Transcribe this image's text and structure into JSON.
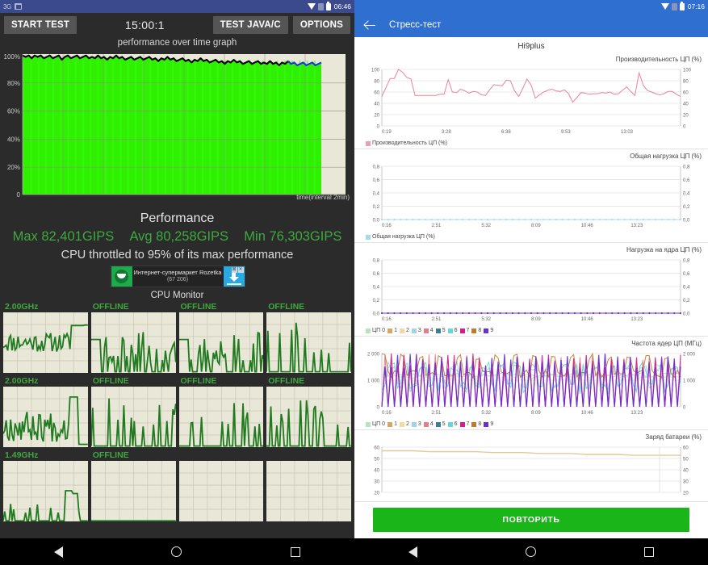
{
  "left": {
    "statusbar": {
      "network": "3G",
      "clock": "06:46",
      "icons": [
        "screenshot-icon",
        "wifi-icon",
        "sim-icon",
        "battery-icon"
      ]
    },
    "toolbar": {
      "start_test": "START TEST",
      "timer": "15:00:1",
      "test_java_c": "TEST JAVA/C",
      "options": "OPTIONS"
    },
    "graph": {
      "title": "performance over time graph",
      "x_axis_label": "time(interval 2min)",
      "y_ticks": [
        "100%",
        "80%",
        "60%",
        "40%",
        "20%",
        "0"
      ]
    },
    "performance": {
      "heading": "Performance",
      "max": "Max 82,401GIPS",
      "avg": "Avg 80,258GIPS",
      "min": "Min 76,303GIPS",
      "throttle_note": "CPU throttled to 95% of its max performance",
      "accent_color": "#3ea93e"
    },
    "ad": {
      "title": "Интернет-супермаркет Rozetka",
      "subtitle": "(67 206)",
      "close_labels": [
        "⊠",
        "✕"
      ]
    },
    "cpu_monitor": {
      "title": "CPU Monitor",
      "cores": [
        {
          "label": "2.00GHz"
        },
        {
          "label": "OFFLINE"
        },
        {
          "label": "OFFLINE"
        },
        {
          "label": "OFFLINE"
        },
        {
          "label": "2.00GHz"
        },
        {
          "label": "OFFLINE"
        },
        {
          "label": "OFFLINE"
        },
        {
          "label": "OFFLINE"
        },
        {
          "label": "1.49GHz"
        },
        {
          "label": "OFFLINE"
        },
        {
          "label": ""
        },
        {
          "label": ""
        }
      ]
    }
  },
  "right": {
    "statusbar": {
      "clock": "07:16",
      "icons": [
        "wifi-icon",
        "sim-icon",
        "battery-icon"
      ]
    },
    "appbar": {
      "title": "Стресс-тест",
      "back": "back-arrow"
    },
    "device_name": "Hi9plus",
    "repeat_button": "ПОВТОРИТЬ",
    "charts": [
      {
        "title": "Производительность ЦП (%)",
        "legend": [
          {
            "label": "Производительность ЦП (%)",
            "color": "#e8a0b4"
          }
        ],
        "y_ticks": [
          "100",
          "80",
          "60",
          "40",
          "20",
          "0"
        ],
        "x_ticks": [
          "0:19",
          "3:28",
          "6:38",
          "9:53",
          "13:03"
        ]
      },
      {
        "title": "Общая нагрузка ЦП (%)",
        "legend": [
          {
            "label": "Общая нагрузка ЦП (%)",
            "color": "#a5dced"
          }
        ],
        "y_ticks": [
          "0,8",
          "0,6",
          "0,4",
          "0,2",
          "0,0"
        ],
        "x_ticks": [
          "0:16",
          "2:51",
          "5:32",
          "8:09",
          "10:46",
          "13:23"
        ]
      },
      {
        "title": "Нагрузка на ядра ЦП (%)",
        "legend": [
          {
            "label": "ЦП 0",
            "color": "#b9e3bd"
          },
          {
            "label": "1",
            "color": "#d6a866"
          },
          {
            "label": "2",
            "color": "#f2d9a0"
          },
          {
            "label": "3",
            "color": "#9fd4e8"
          },
          {
            "label": "4",
            "color": "#e8798f"
          },
          {
            "label": "5",
            "color": "#3a7f96"
          },
          {
            "label": "6",
            "color": "#5fd9de"
          },
          {
            "label": "7",
            "color": "#d81b8c"
          },
          {
            "label": "8",
            "color": "#c07a28"
          },
          {
            "label": "9",
            "color": "#6a2fd0"
          }
        ],
        "y_ticks": [
          "0,8",
          "0,6",
          "0,4",
          "0,2",
          "0,0"
        ],
        "x_ticks": [
          "0:16",
          "2:51",
          "5:32",
          "8:09",
          "10:46",
          "13:23"
        ]
      },
      {
        "title": "Частота ядер ЦП (МГц)",
        "legend": [
          {
            "label": "ЦП 0",
            "color": "#b9e3bd"
          },
          {
            "label": "1",
            "color": "#d6a866"
          },
          {
            "label": "2",
            "color": "#f2d9a0"
          },
          {
            "label": "3",
            "color": "#9fd4e8"
          },
          {
            "label": "4",
            "color": "#e8798f"
          },
          {
            "label": "5",
            "color": "#3a7f96"
          },
          {
            "label": "6",
            "color": "#5fd9de"
          },
          {
            "label": "7",
            "color": "#d81b8c"
          },
          {
            "label": "8",
            "color": "#c07a28"
          },
          {
            "label": "9",
            "color": "#6a2fd0"
          }
        ],
        "y_ticks": [
          "2 000",
          "1 000",
          "0"
        ],
        "x_ticks": [
          "0:16",
          "2:51",
          "5:32",
          "8:09",
          "10:46",
          "13:23"
        ]
      },
      {
        "title": "Заряд батареи (%)",
        "legend": [],
        "y_ticks": [
          "60",
          "50",
          "40",
          "30",
          "20"
        ],
        "x_ticks": []
      }
    ]
  },
  "navbar": {
    "back": "back-triangle-icon",
    "home": "home-circle-icon",
    "recent": "recent-square-icon"
  },
  "chart_data": [
    {
      "type": "area",
      "title": "performance over time graph",
      "xlabel": "time(interval 2min)",
      "ylabel": "%",
      "ylim": [
        0,
        100
      ],
      "series": [
        {
          "name": "performance",
          "color": "#000000",
          "values": [
            99,
            98,
            99,
            97,
            99,
            98,
            99,
            97,
            98,
            99,
            97,
            98,
            99,
            96,
            98,
            99,
            97,
            98,
            99,
            97,
            98,
            99,
            97,
            98,
            97,
            99,
            97,
            98,
            96,
            98,
            97,
            99,
            97,
            98,
            96,
            97,
            98,
            96,
            97,
            98,
            96,
            97,
            98,
            96,
            97,
            95,
            97,
            96,
            98,
            96,
            97,
            95,
            96,
            97,
            95,
            96,
            94,
            96,
            95,
            97,
            95,
            96,
            94,
            95,
            96,
            94,
            95,
            93,
            95,
            94,
            96,
            94,
            95,
            93,
            94,
            95,
            93,
            94,
            95,
            93,
            94,
            93,
            95,
            93,
            94,
            92,
            94,
            93,
            95,
            93,
            94,
            92,
            93,
            94,
            92,
            93,
            94,
            92,
            93,
            94
          ]
        }
      ]
    },
    {
      "type": "line",
      "title": "Производительность ЦП (%)",
      "ylim": [
        0,
        100
      ],
      "ylabel": "%",
      "x_ticks": [
        "0:19",
        "3:28",
        "6:38",
        "9:53",
        "13:03"
      ],
      "series": [
        {
          "name": "Производительность ЦП (%)",
          "color": "#e8849c",
          "values": [
            52,
            68,
            84,
            84,
            100,
            95,
            86,
            83,
            54,
            54,
            54,
            54,
            54,
            54,
            56,
            56,
            82,
            60,
            59,
            65,
            62,
            58,
            61,
            60,
            55,
            54,
            64,
            73,
            72,
            71,
            81,
            80,
            62,
            52,
            67,
            83,
            72,
            49,
            55,
            60,
            63,
            65,
            62,
            61,
            64,
            57,
            42,
            50,
            59,
            58,
            56,
            57,
            57,
            59,
            58,
            60,
            56,
            57,
            63,
            69,
            61,
            54,
            94,
            72,
            63,
            60,
            57,
            55,
            57,
            61,
            61,
            56,
            52
          ]
        }
      ]
    },
    {
      "type": "line",
      "title": "Общая нагрузка ЦП (%)",
      "ylim": [
        0,
        0.9
      ],
      "x_ticks": [
        "0:16",
        "2:51",
        "5:32",
        "8:09",
        "10:46",
        "13:23"
      ],
      "series": [
        {
          "name": "Общая нагрузка ЦП (%)",
          "color": "#a5dced",
          "values": [
            0
          ]
        }
      ]
    },
    {
      "type": "line",
      "title": "Нагрузка на ядра ЦП (%)",
      "ylim": [
        0,
        0.9
      ],
      "x_ticks": [
        "0:16",
        "2:51",
        "5:32",
        "8:09",
        "10:46",
        "13:23"
      ],
      "series": [
        {
          "name": "ЦП 0",
          "color": "#b9e3bd",
          "values": [
            0
          ]
        },
        {
          "name": "1",
          "color": "#d6a866",
          "values": [
            0
          ]
        },
        {
          "name": "2",
          "color": "#f2d9a0",
          "values": [
            0
          ]
        },
        {
          "name": "3",
          "color": "#9fd4e8",
          "values": [
            0
          ]
        },
        {
          "name": "4",
          "color": "#e8798f",
          "values": [
            0
          ]
        },
        {
          "name": "5",
          "color": "#3a7f96",
          "values": [
            0
          ]
        },
        {
          "name": "6",
          "color": "#5fd9de",
          "values": [
            0
          ]
        },
        {
          "name": "7",
          "color": "#d81b8c",
          "values": [
            0
          ]
        },
        {
          "name": "8",
          "color": "#c07a28",
          "values": [
            0
          ]
        },
        {
          "name": "9",
          "color": "#6a2fd0",
          "values": [
            0
          ]
        }
      ]
    },
    {
      "type": "line",
      "title": "Частота ядер ЦП (МГц)",
      "ylim": [
        0,
        2600
      ],
      "x_ticks": [
        "0:16",
        "2:51",
        "5:32",
        "8:09",
        "10:46",
        "13:23"
      ],
      "series": [
        {
          "name": "ЦП 0",
          "color": "#b9e3bd",
          "values": [
            1950,
            1500,
            1400,
            1500,
            1450,
            1400,
            1500,
            1400,
            1450,
            1400
          ]
        },
        {
          "name": "8",
          "color": "#c07a28",
          "values": [
            2550,
            1800,
            2550,
            1700,
            1500,
            1450,
            1500,
            2550,
            2550,
            1500
          ]
        },
        {
          "name": "9",
          "color": "#6a2fd0",
          "values": [
            2550,
            0,
            2050,
            0,
            2550,
            0,
            1900,
            0,
            2050,
            0
          ]
        },
        {
          "name": "7",
          "color": "#d81b8c",
          "values": [
            1900,
            0,
            1900,
            0,
            2050,
            0,
            1900,
            0,
            1900,
            0
          ]
        },
        {
          "name": "6",
          "color": "#5fd9de",
          "values": [
            2000,
            1200,
            2000,
            1000,
            2050,
            800,
            2050,
            1000,
            2050,
            900
          ]
        },
        {
          "name": "2",
          "color": "#f2d9a0",
          "values": [
            1500,
            1450,
            1500,
            1450,
            1500,
            1450,
            1500,
            1450,
            1500,
            1450
          ]
        }
      ]
    },
    {
      "type": "line",
      "title": "Заряд батареи (%)",
      "ylim": [
        15,
        65
      ],
      "series": [
        {
          "name": "Заряд батареи (%)",
          "color": "#e3c99a",
          "values": [
            61,
            61,
            61,
            60,
            60,
            60,
            60,
            59,
            59,
            59,
            58,
            58,
            58,
            57,
            57,
            57,
            56,
            56,
            56,
            56
          ]
        }
      ]
    }
  ]
}
